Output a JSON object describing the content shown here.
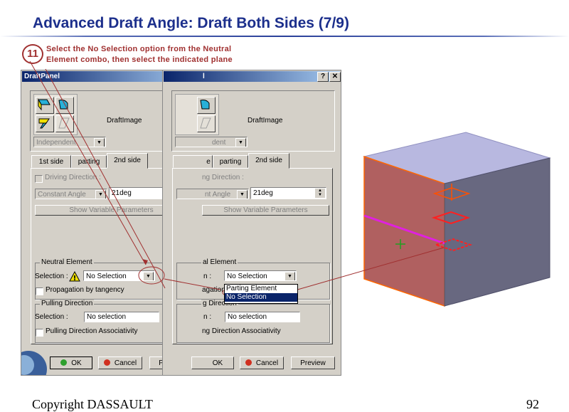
{
  "slide": {
    "title": "Advanced Draft Angle: Draft Both Sides (7/9)",
    "step_number": "11",
    "step_line1": "Select the No Selection option from the Neutral",
    "step_line2": "Element combo, then select the indicated plane",
    "copyright": "Copyright DASSAULT",
    "page_number": "92"
  },
  "panel_left": {
    "title": "DraftPanel",
    "help_btn": "?",
    "close_btn": "✕",
    "draft_image_label": "DraftImage",
    "mode_combo": "Independent",
    "tabs": [
      "1st side",
      "parting",
      "2nd side"
    ],
    "driving_direction": "Driving Direction :",
    "angle_mode": "Constant Angle",
    "angle_value": "21deg",
    "show_variable": "Show Variable Parameters",
    "neutral_group": "Neutral Element",
    "selection_label": "Selection :",
    "neutral_selection": "No Selection",
    "propagation": "Propagation by tangency",
    "pulling_group": "Pulling Direction",
    "pulling_selection_label": "Selection :",
    "pulling_selection": "No selection",
    "pulling_assoc": "Pulling Direction Associativity",
    "ok": "OK",
    "cancel": "Cancel",
    "preview": "Preview"
  },
  "panel_right": {
    "title_fragment": "l",
    "help_btn": "?",
    "close_btn": "✕",
    "draft_image_label": "DraftImage",
    "mode_combo": "dent",
    "tabs": [
      "e",
      "parting",
      "2nd side"
    ],
    "driving_direction": "ng Direction :",
    "angle_mode": "nt Angle",
    "angle_value": "21deg",
    "show_variable": "Show Variable Parameters",
    "neutral_group": "al Element",
    "selection_label": "n :",
    "neutral_selection": "No Selection",
    "dropdown_options": [
      "Parting Element",
      "No Selection"
    ],
    "propagation_fragment": "agation",
    "pulling_group": "g Direction",
    "pulling_selection_label": "n :",
    "pulling_selection": "No selection",
    "pulling_assoc": "ng Direction Associativity",
    "ok": "OK",
    "cancel": "Cancel",
    "preview": "Preview"
  },
  "colors": {
    "title": "#1c2f8c",
    "annotation": "#a03030",
    "selection_highlight": "#0a246a",
    "cube_top": "#b8b8e0",
    "cube_front": "#b06060",
    "cube_side": "#686880",
    "edge_highlight": "#ff6600",
    "parting_line": "#e020e0"
  },
  "icons": [
    "step-badge",
    "help-icon",
    "close-icon",
    "draft-both-icon",
    "draft-angle-icon",
    "warning-icon",
    "combo-arrow-icon",
    "ok-dot-icon",
    "cancel-dot-icon",
    "plane-icon",
    "axis-icon"
  ]
}
